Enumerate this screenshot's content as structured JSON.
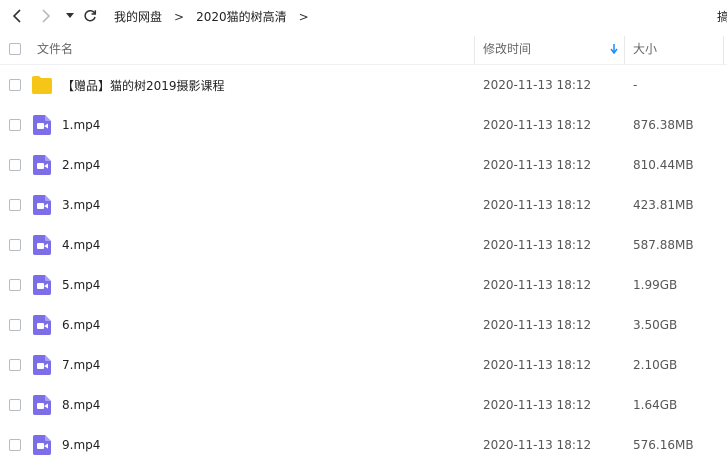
{
  "toolbar": {
    "breadcrumbs": [
      "我的网盘",
      "2020猫的树高清"
    ],
    "sep": ">",
    "cut_label": "搞"
  },
  "header": {
    "name": "文件名",
    "modified": "修改时间",
    "size": "大小"
  },
  "colors": {
    "folder": "#f5c518",
    "video": "#7b6ee8",
    "sort_arrow": "#1a8cff"
  },
  "files": [
    {
      "type": "folder",
      "name": "【赠品】猫的树2019摄影课程",
      "date": "2020-11-13 18:12",
      "size": "-"
    },
    {
      "type": "video",
      "name": "1.mp4",
      "date": "2020-11-13 18:12",
      "size": "876.38MB"
    },
    {
      "type": "video",
      "name": "2.mp4",
      "date": "2020-11-13 18:12",
      "size": "810.44MB"
    },
    {
      "type": "video",
      "name": "3.mp4",
      "date": "2020-11-13 18:12",
      "size": "423.81MB"
    },
    {
      "type": "video",
      "name": "4.mp4",
      "date": "2020-11-13 18:12",
      "size": "587.88MB"
    },
    {
      "type": "video",
      "name": "5.mp4",
      "date": "2020-11-13 18:12",
      "size": "1.99GB"
    },
    {
      "type": "video",
      "name": "6.mp4",
      "date": "2020-11-13 18:12",
      "size": "3.50GB"
    },
    {
      "type": "video",
      "name": "7.mp4",
      "date": "2020-11-13 18:12",
      "size": "2.10GB"
    },
    {
      "type": "video",
      "name": "8.mp4",
      "date": "2020-11-13 18:12",
      "size": "1.64GB"
    },
    {
      "type": "video",
      "name": "9.mp4",
      "date": "2020-11-13 18:12",
      "size": "576.16MB"
    }
  ]
}
